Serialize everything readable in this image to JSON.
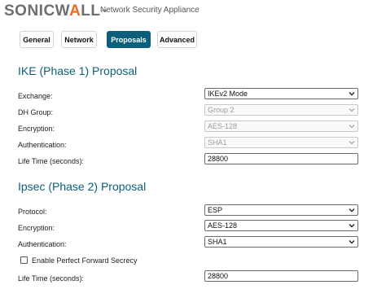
{
  "header": {
    "brand": "SONICWALL",
    "subtitle": "Network Security Appliance"
  },
  "tabs": [
    {
      "label": "General",
      "active": false
    },
    {
      "label": "Network",
      "active": false
    },
    {
      "label": "Proposals",
      "active": true
    },
    {
      "label": "Advanced",
      "active": false
    }
  ],
  "ike": {
    "title": "IKE (Phase 1) Proposal",
    "exchange_label": "Exchange:",
    "exchange_value": "IKEv2 Mode",
    "dh_label": "DH Group:",
    "dh_value": "Group 2",
    "encryption_label": "Encryption:",
    "encryption_value": "AES-128",
    "auth_label": "Authentication:",
    "auth_value": "SHA1",
    "lifetime_label": "Life Time (seconds):",
    "lifetime_value": "28800"
  },
  "ipsec": {
    "title": "Ipsec (Phase 2) Proposal",
    "protocol_label": "Protocol:",
    "protocol_value": "ESP",
    "encryption_label": "Encryption:",
    "encryption_value": "AES-128",
    "auth_label": "Authentication:",
    "auth_value": "SHA1",
    "pfs_label": "Enable Perfect Forward Secrecy",
    "pfs_checked": false,
    "lifetime_label": "Life Time (seconds):",
    "lifetime_value": "28800"
  },
  "colors": {
    "accent": "#0b5f7a",
    "logo_orange": "#f36c21"
  }
}
